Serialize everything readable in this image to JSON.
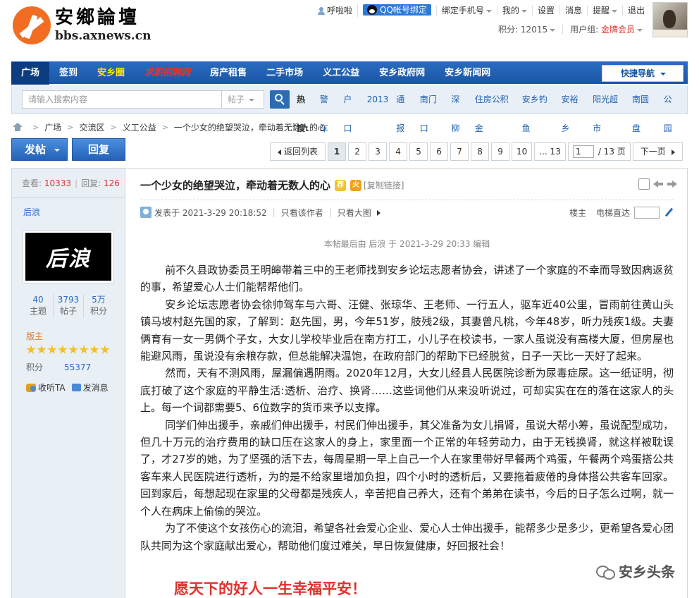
{
  "logo": {
    "name": "安鄉論壇",
    "url": "bbs.axnews.cn"
  },
  "userbar": {
    "username": "呼啦啦",
    "qq_bind": "QQ帐号绑定",
    "bind_phone": "绑定手机号",
    "my": "我的",
    "settings": "设置",
    "messages": "消息",
    "reminders": "提醒",
    "logout": "退出",
    "points_label": "积分: 12015",
    "group_label": "用户组:",
    "group_value": "金牌会员"
  },
  "nav": {
    "items": [
      "广场",
      "签到",
      "安乡圈",
      "求职招聘网",
      "房产租售",
      "二手市场",
      "义工公益",
      "安乡政府网",
      "安乡新闻网"
    ],
    "quick_nav": "快捷导航"
  },
  "search": {
    "placeholder": "请输入搜索内容",
    "type": "帖子",
    "hot_label": "热搜:",
    "hot_keywords": [
      "警车",
      "户口",
      "2013",
      "通报",
      "南门口",
      "深柳",
      "住房公积金",
      "安乡钓鱼",
      "安裕乡",
      "阳光超市",
      "南圆盘",
      "公园"
    ]
  },
  "breadcrumb": [
    "广场",
    "交流区",
    "义工公益",
    "一个少女的绝望哭泣，牵动着无数人的心"
  ],
  "actions": {
    "post": "发帖",
    "reply": "回复"
  },
  "pager": {
    "back": "返回列表",
    "pages": [
      "1",
      "2",
      "3",
      "4",
      "5",
      "6",
      "7",
      "8",
      "9",
      "10",
      "... 13"
    ],
    "current": "1",
    "total": "/ 13 页",
    "next": "下一页"
  },
  "sidebar": {
    "views_label": "查看:",
    "views": "10333",
    "replies_label": "回复:",
    "replies": "126",
    "author": "后浪",
    "avatar_text": "后浪",
    "counts": [
      {
        "value": "40",
        "label": "主题"
      },
      {
        "value": "3793",
        "label": "帖子"
      },
      {
        "value": "5万",
        "label": "积分"
      }
    ],
    "role": "版主",
    "star_count": 8,
    "points_label": "积分",
    "points_value": "55377",
    "follow": "收听TA",
    "message": "发消息"
  },
  "post": {
    "title": "一个少女的绝望哭泣，牵动着无数人的心",
    "badge_jian": "荐",
    "badge_huo": "火",
    "copy_link": "[复制链接]",
    "posted_at": "发表于 2021-3-29 20:18:52",
    "only_author": "只看该作者",
    "only_image": "只看大图",
    "floor": "楼主",
    "elevator": "电梯直达",
    "edit_note": "本帖最后由 后浪 于 2021-3-29 20:33 编辑",
    "paragraphs": [
      "前不久县政协委员王明皞带着三中的王老师找到安乡论坛志愿者协会，讲述了一个家庭的不幸而导致因病返贫的事，希望爱心人士们能帮帮他们。",
      "安乡论坛志愿者协会徐帅驾车与六哥、汪健、张琼华、王老师、一行五人，驱车近40公里，冒雨前往黄山头镇马坡村赵先国的家，了解到：赵先国，男，今年51岁，肢残2级，其妻曾凡桃，今年48岁，听力残疾1级。夫妻俩育有一女一男俩个子女，大女儿学校毕业后在南方打工，小儿子在校读书，一家人虽说没有高楼大厦，但房屋也能避风雨，虽说没有余粮存款，但总能解决温饱，在政府部门的帮助下已经脱贫，日子一天比一天好了起来。",
      "然而，天有不测风雨，屋漏偏遇阴雨。2020年12月，大女儿经县人民医院诊断为尿毒症尿。这一纸证明，彻底打破了这个家庭的平静生活:透析、治疗、换肾……这些词他们从来没听说过，可却实实在在的落在这家人的头上。每一个词都需要5、6位数字的货币来予以支撑。",
      "同学们伸出援手，亲戚们伸出援手，村民们伸出援手，其父准备为女儿捐肾，虽说大帮小筹，虽说配型成功，但几十万元的治疗费用的缺口压在这家人的身上，家里面一个正常的年轻劳动力，由于无钱换肾，就这样被耽误了，才27岁的她，为了坚强的活下去，每周星期一早上自己一个人在家里带好早餐两个鸡蛋，午餐两个鸡蛋搭公共客车来人民医院进行透析，为的是不给家里增加负担，四个小时的透析后，又要拖着疲倦的身体搭公共客车回家。回到家后，每想起现在家里的父母都是残疾人，辛苦把自己养大，还有个弟弟在读书，今后的日子怎么过啊，就一个人在病床上偷偷的哭泣。",
      "为了不使这个女孩伤心的流泪，希望各社会爱心企业、爱心人士伸出援手，能帮多少是多少，更希望各爱心团队共同为这个家庭献出爱心，帮助他们度过难关，早日恢复健康，好回报社会！"
    ],
    "wish": "愿天下的好人一生幸福平安！",
    "watermark": "安乡头条"
  },
  "colors": {
    "nav_blue": "#1a55a4",
    "accent_red": "#e0312d",
    "link_blue": "#2a6cc0"
  }
}
